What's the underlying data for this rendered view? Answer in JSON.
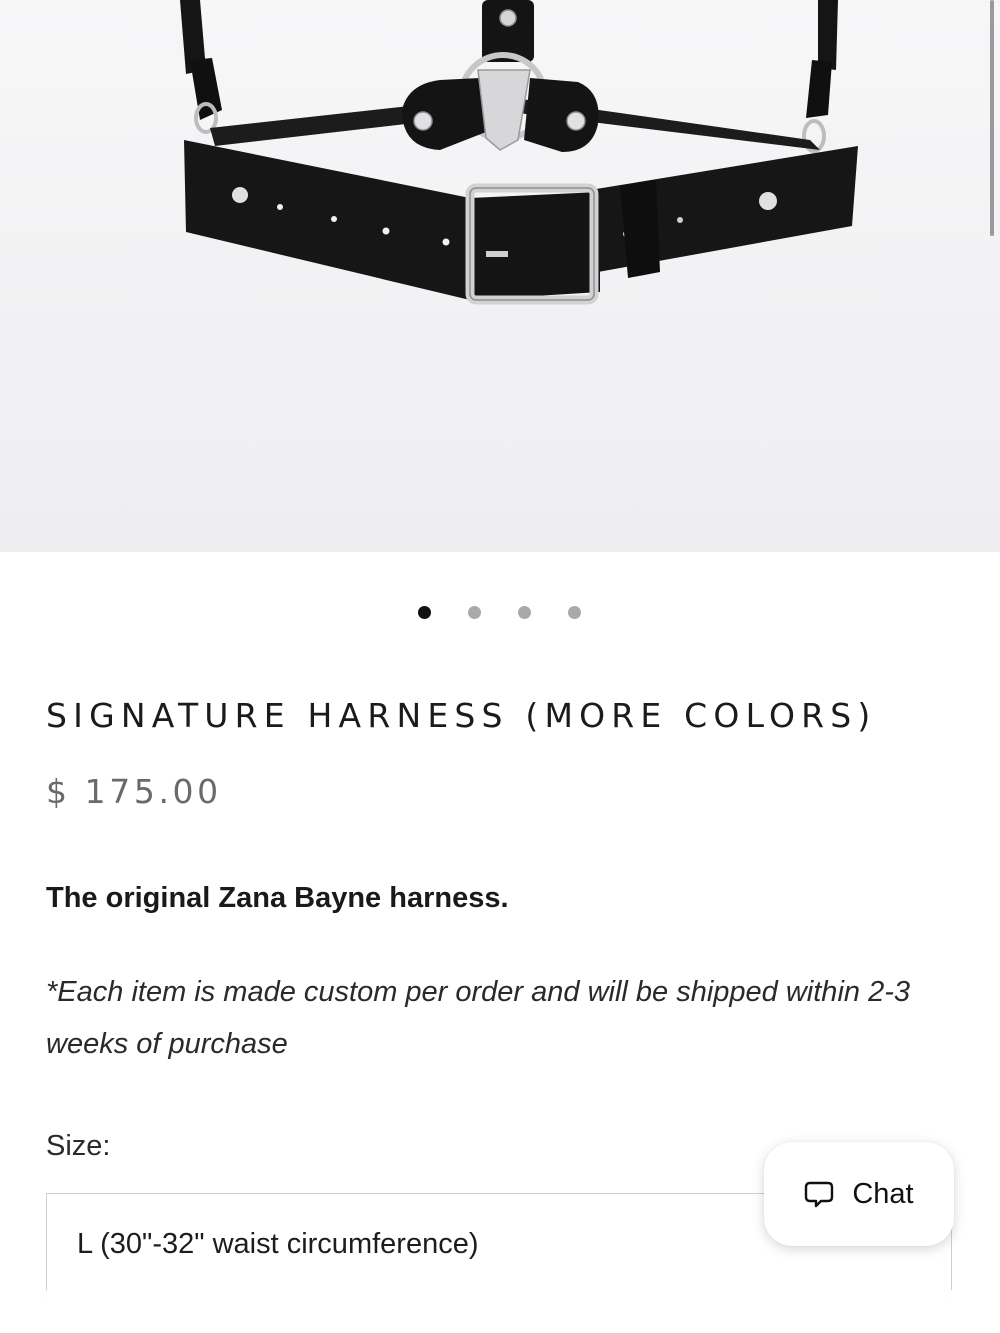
{
  "product": {
    "title": "SIGNATURE HARNESS (MORE COLORS)",
    "price": "$ 175.00",
    "tagline": "The original Zana Bayne harness.",
    "note": "*Each item is made custom per order and will be shipped within 2-3 weeks of purchase"
  },
  "carousel": {
    "total_images": 4,
    "active_index": 1
  },
  "size": {
    "label": "Size:",
    "selected": "L (30\"-32\" waist circumference)"
  },
  "chat": {
    "label": "Chat",
    "icon": "chat-bubble-icon"
  },
  "colors": {
    "leather": "#141414",
    "hardware": "#c9c9cc",
    "background": "#f2f2f4",
    "dot_active": "#111111",
    "dot_inactive": "#a9a9a9"
  }
}
